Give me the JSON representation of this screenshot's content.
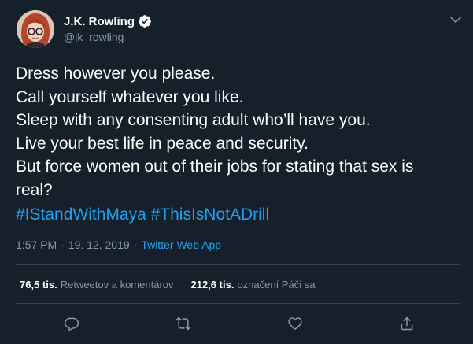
{
  "author": {
    "display_name": "J.K. Rowling",
    "handle": "@jk_rowling",
    "verified": true
  },
  "tweet": {
    "lines": [
      "Dress however you please.",
      "Call yourself whatever you like.",
      "Sleep with any consenting adult who’ll have you.",
      "Live your best life in peace and security.",
      "But force women out of their jobs for stating that sex is",
      "real?"
    ],
    "hashtags": [
      "#IStandWithMaya",
      "#ThisIsNotADrill"
    ]
  },
  "meta": {
    "time": "1:57 PM",
    "separator": "·",
    "date": "19. 12. 2019",
    "source": "Twitter Web App"
  },
  "stats": {
    "retweets_count": "76,5 tis.",
    "retweets_label": "Retweetov a komentárov",
    "likes_count": "212,6 tis.",
    "likes_label": "označení Páči sa"
  },
  "icons": {
    "verified": "verified-badge-icon",
    "caret": "chevron-down-icon",
    "reply": "reply-icon",
    "retweet": "retweet-icon",
    "like": "heart-icon",
    "share": "share-icon"
  },
  "colors": {
    "background": "#15202b",
    "text": "#ffffff",
    "muted": "#8899a6",
    "accent": "#1da1f2",
    "divider": "#38444d"
  }
}
